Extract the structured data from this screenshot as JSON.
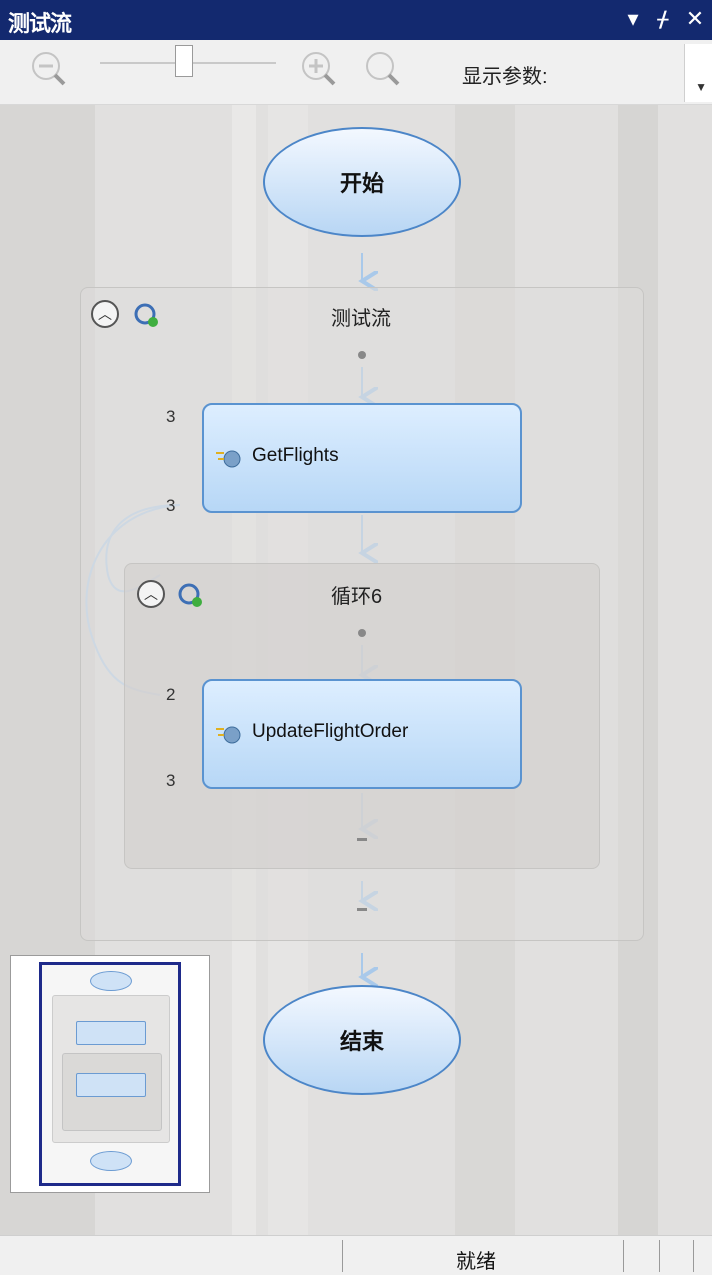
{
  "titlebar": {
    "title": "测试流",
    "dropdown_glyph": "▾",
    "pin_glyph": "ᚋ",
    "close_glyph": "✕"
  },
  "toolbar": {
    "zoom_out_icon": "zoom-out-icon",
    "zoom_in_icon": "zoom-in-icon",
    "zoom_fit_icon": "zoom-fit-icon",
    "zoom_slider_value": 0.43,
    "display_params_label": "显示参数:",
    "display_params_value": ""
  },
  "flow": {
    "start_label": "开始",
    "end_label": "结束",
    "test_flow_group": {
      "title": "测试流",
      "action": {
        "label": "GetFlights",
        "in_count": "3",
        "out_count": "3"
      }
    },
    "loop_group": {
      "title": "循环6",
      "action": {
        "label": "UpdateFlightOrder",
        "in_count": "2",
        "out_count": "3"
      }
    }
  },
  "colors": {
    "titlebar_bg": "#13296f",
    "node_fill_top": "#ddeeff",
    "node_fill_bottom": "#b7d7f6",
    "node_border": "#5a93d0",
    "connector": "#a9c9ea",
    "canvas_bg": "#e1e0df"
  },
  "statusbar": {
    "status_text": "就绪"
  }
}
